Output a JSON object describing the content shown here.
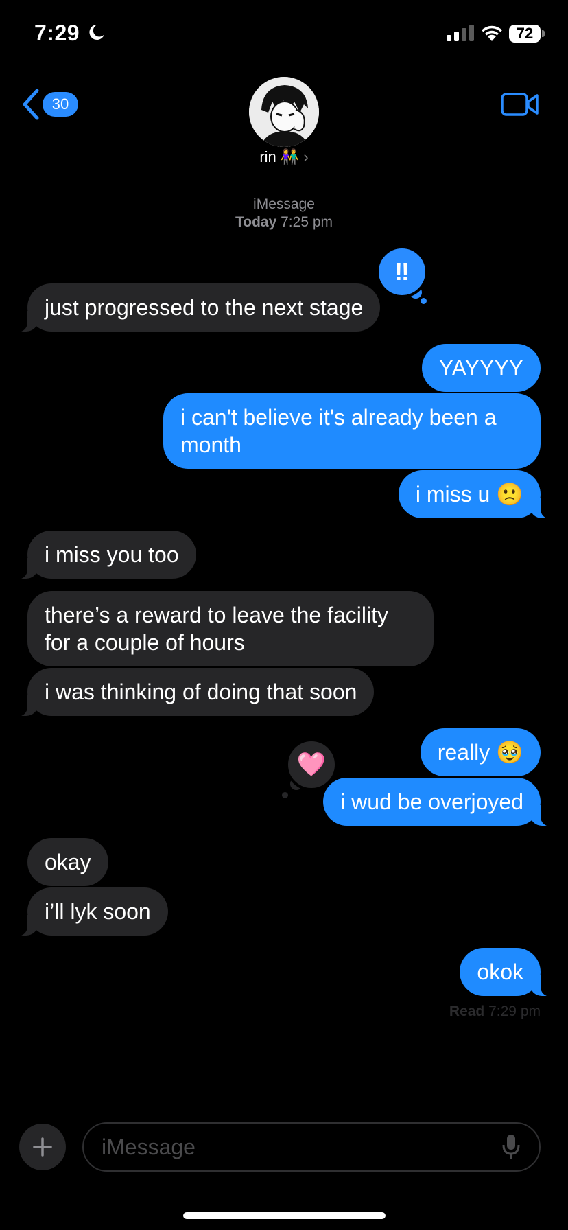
{
  "status_bar": {
    "time": "7:29",
    "battery": "72"
  },
  "header": {
    "back_count": "30",
    "contact_name": "rin",
    "contact_emoji": "👫"
  },
  "thread_meta": {
    "service": "iMessage",
    "day": "Today",
    "time": "7:25 pm"
  },
  "messages": [
    {
      "dir": "in",
      "text": "just progressed to the next stage",
      "tapback": "‼"
    },
    {
      "dir": "out",
      "text": "YAYYYY"
    },
    {
      "dir": "out",
      "text": "i can't believe it's already been a month"
    },
    {
      "dir": "out",
      "text": "i miss u",
      "emoji": "🙁"
    },
    {
      "dir": "in",
      "text": "i miss you too"
    },
    {
      "dir": "in",
      "text": "there’s a reward to leave the facility for a couple of hours"
    },
    {
      "dir": "in",
      "text": "i was thinking of doing that soon"
    },
    {
      "dir": "out",
      "text": "really",
      "emoji": "🥹"
    },
    {
      "dir": "out",
      "text": "i wud be overjoyed",
      "tapback": "🩷"
    },
    {
      "dir": "in",
      "text": "okay"
    },
    {
      "dir": "in",
      "text": "i’ll lyk soon"
    },
    {
      "dir": "out",
      "text": "okok"
    }
  ],
  "read_receipt": {
    "label": "Read",
    "time": "7:29 pm"
  },
  "composer": {
    "placeholder": "iMessage"
  },
  "colors": {
    "outgoing": "#1f8bff",
    "incoming": "#262628",
    "accent": "#2a8cff",
    "background": "#000000"
  },
  "icons": [
    "moon-icon",
    "signal-icon",
    "wifi-icon",
    "back-chevron-icon",
    "video-camera-icon",
    "plus-icon",
    "microphone-icon"
  ]
}
